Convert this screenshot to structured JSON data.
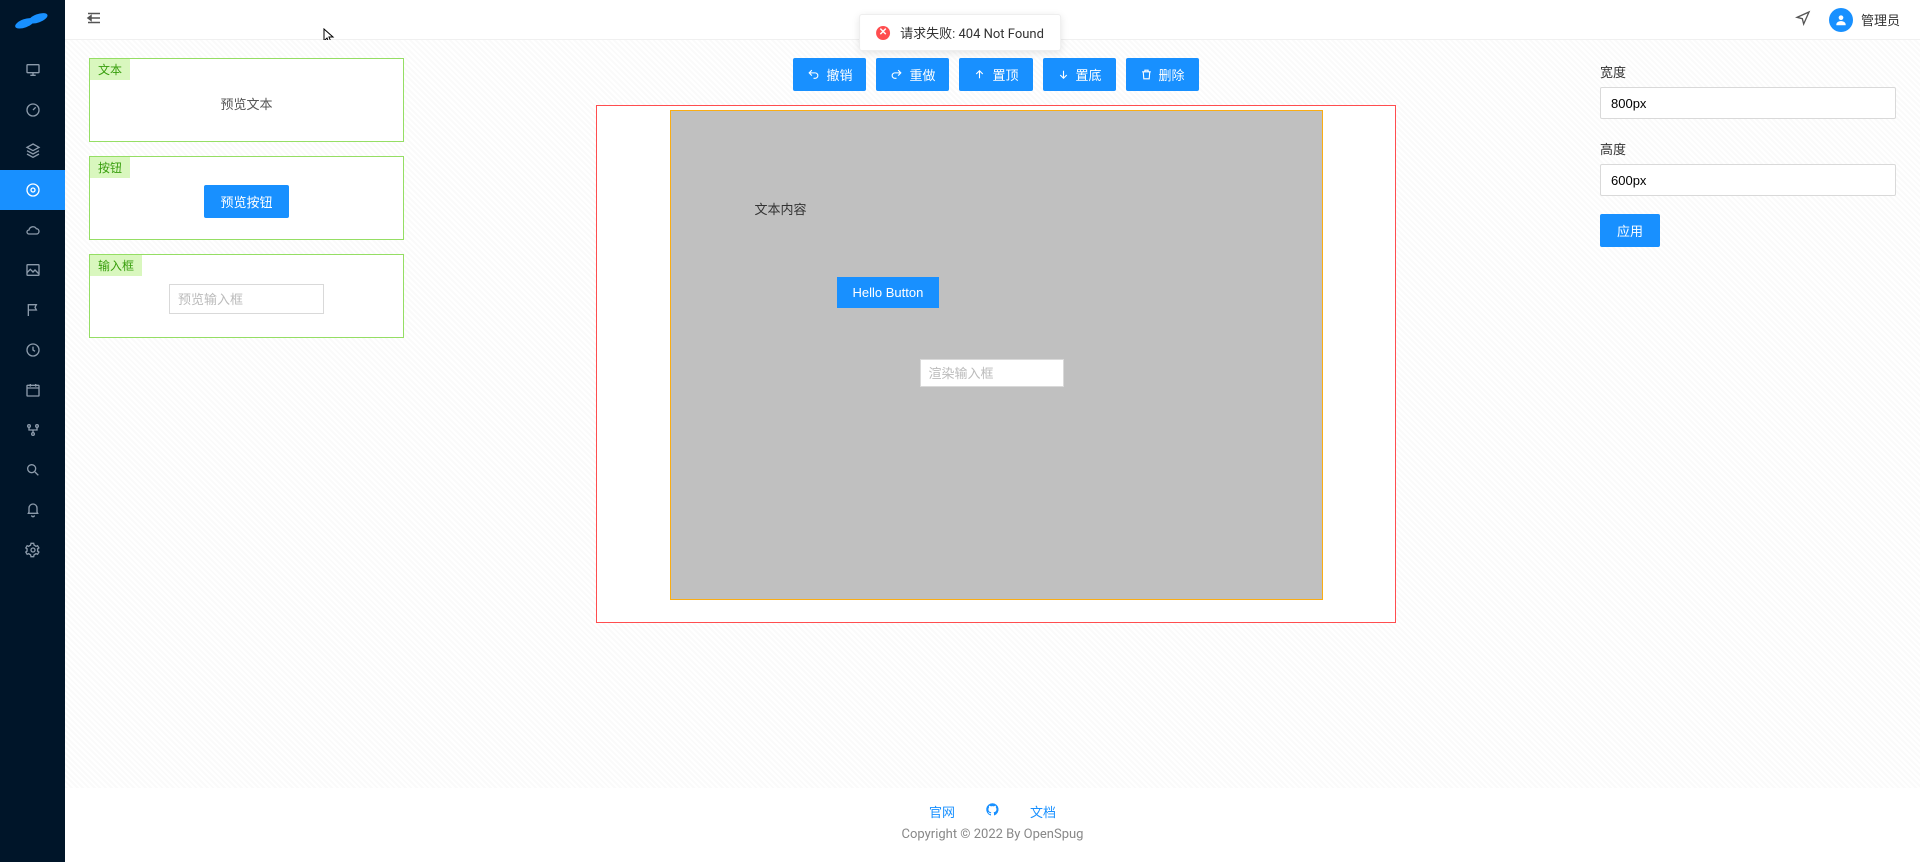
{
  "header": {
    "user_label": "管理员"
  },
  "toast": {
    "message": "请求失败: 404 Not Found"
  },
  "palette": {
    "text_tag": "文本",
    "text_preview": "预览文本",
    "button_tag": "按钮",
    "button_preview": "预览按钮",
    "input_tag": "输入框",
    "input_placeholder": "预览输入框"
  },
  "toolbar": {
    "undo": "撤销",
    "redo": "重做",
    "top": "置顶",
    "bottom": "置底",
    "delete": "删除"
  },
  "canvas": {
    "text_content": "文本内容",
    "button_label": "Hello Button",
    "input_placeholder": "渲染输入框"
  },
  "props": {
    "width_label": "宽度",
    "width_value": "800px",
    "height_label": "高度",
    "height_value": "600px",
    "apply_label": "应用"
  },
  "footer": {
    "link_site": "官网",
    "link_docs": "文档",
    "copyright": "Copyright © 2022 By OpenSpug"
  }
}
